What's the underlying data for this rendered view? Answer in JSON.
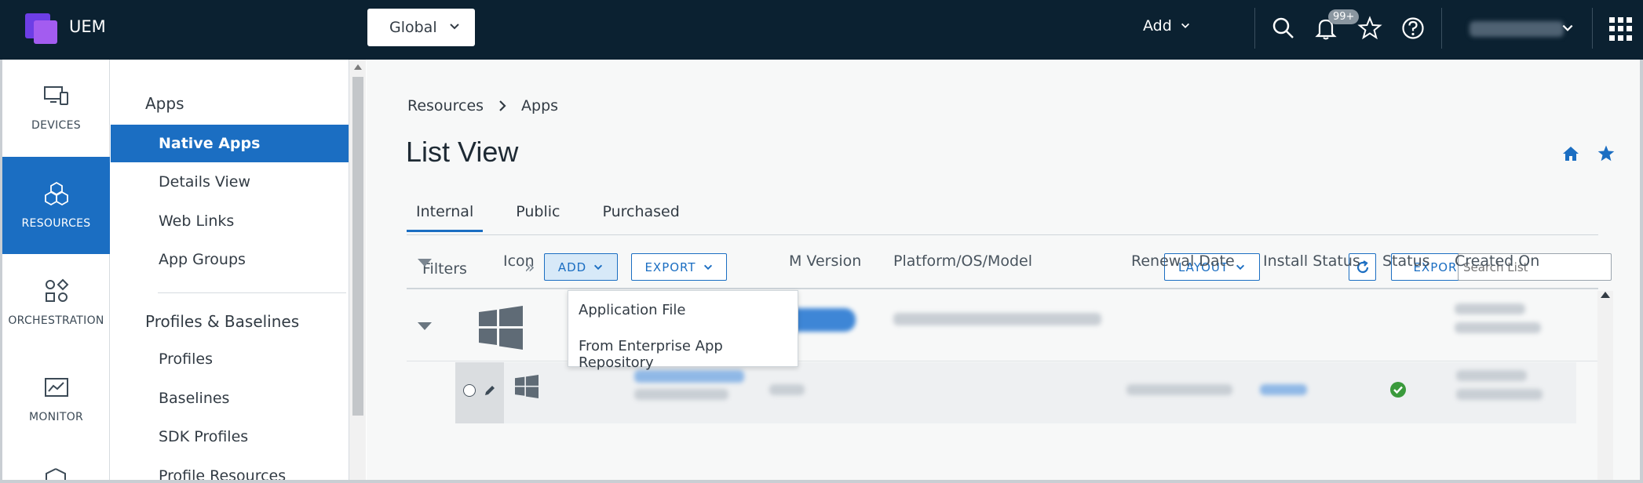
{
  "app": {
    "name": "UEM"
  },
  "header": {
    "org_select": "Global",
    "add_label": "Add",
    "notification_badge": "99+"
  },
  "rail": [
    {
      "label": "DEVICES",
      "icon": "devices-icon"
    },
    {
      "label": "RESOURCES",
      "icon": "resources-icon",
      "active": true
    },
    {
      "label": "ORCHESTRATION",
      "icon": "orchestration-icon"
    },
    {
      "label": "MONITOR",
      "icon": "monitor-icon"
    }
  ],
  "subnav": {
    "apps_heading": "Apps",
    "apps_items": [
      "Native Apps",
      "Details View",
      "Web Links",
      "App Groups"
    ],
    "profiles_heading": "Profiles & Baselines",
    "profiles_items": [
      "Profiles",
      "Baselines",
      "SDK Profiles",
      "Profile Resources"
    ]
  },
  "breadcrumb": [
    "Resources",
    "Apps"
  ],
  "page_title": "List View",
  "tabs": [
    "Internal",
    "Public",
    "Purchased"
  ],
  "toolbar": {
    "filters": "Filters",
    "add": "ADD",
    "export": "EXPORT",
    "layout": "LAYOUT",
    "export2": "EXPORT",
    "search_placeholder": "Search List"
  },
  "dropdown": [
    "Application File",
    "From Enterprise App Repository"
  ],
  "table": {
    "columns": [
      "Icon",
      "M Version",
      "Platform/OS/Model",
      "Renewal Date",
      "Install Status",
      "Status",
      "Created On"
    ]
  },
  "colors": {
    "accent": "#1b6ec2",
    "topbar": "#0b2131",
    "success": "#3a9a3c"
  }
}
